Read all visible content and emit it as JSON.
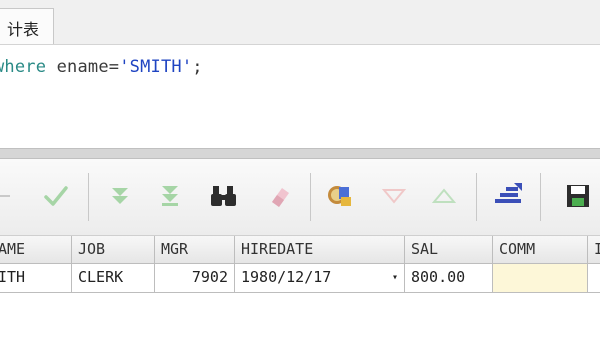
{
  "tab": {
    "label": "计表"
  },
  "editor": {
    "kw_where": "where",
    "ident": " ename=",
    "string": "'SMITH'",
    "end": ";"
  },
  "toolbar": {
    "buttons": [
      {
        "name": "minus-button",
        "icon": "minus-icon"
      },
      {
        "name": "post-button",
        "icon": "checkmark-icon"
      },
      {
        "name": "fetch-next-button",
        "icon": "double-down-icon"
      },
      {
        "name": "fetch-last-button",
        "icon": "double-down-end-icon"
      },
      {
        "name": "find-button",
        "icon": "binoculars-icon"
      },
      {
        "name": "clear-button",
        "icon": "eraser-icon"
      },
      {
        "name": "query-button",
        "icon": "query-by-example-icon"
      },
      {
        "name": "sort-desc-button",
        "icon": "triangle-down-icon"
      },
      {
        "name": "sort-asc-button",
        "icon": "triangle-up-icon"
      },
      {
        "name": "export-button",
        "icon": "export-icon"
      },
      {
        "name": "save-button",
        "icon": "floppy-disk-icon"
      }
    ],
    "colors": {
      "inactive_green": "#a6d5a6",
      "blue": "#3b4fb8",
      "dark": "#2d2d2d"
    }
  },
  "grid": {
    "headers": [
      "AME",
      "JOB",
      "MGR",
      "HIREDATE",
      "SAL",
      "COMM",
      "I"
    ],
    "row": {
      "ename": "ITH",
      "job": "CLERK",
      "mgr": "7902",
      "hiredate": "1980/12/17",
      "dropdown": "▾",
      "sal": "800.00",
      "comm": "",
      "last": ""
    }
  }
}
